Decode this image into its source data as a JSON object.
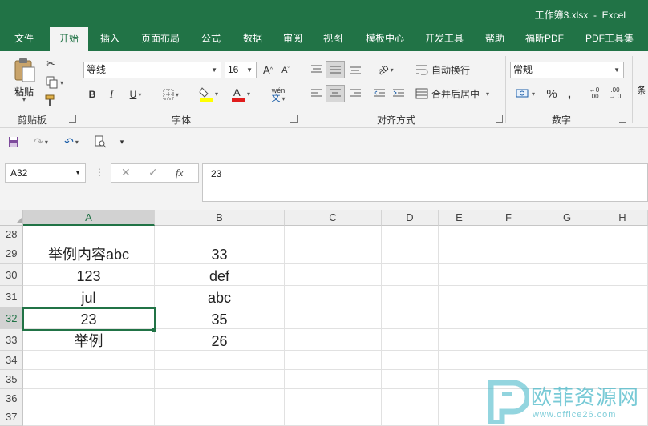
{
  "window": {
    "title": "工作簿3.xlsx  -  Excel"
  },
  "tabs": [
    {
      "label": "文件"
    },
    {
      "label": "开始"
    },
    {
      "label": "插入"
    },
    {
      "label": "页面布局"
    },
    {
      "label": "公式"
    },
    {
      "label": "数据"
    },
    {
      "label": "审阅"
    },
    {
      "label": "视图"
    },
    {
      "label": "模板中心"
    },
    {
      "label": "开发工具"
    },
    {
      "label": "帮助"
    },
    {
      "label": "福昕PDF"
    },
    {
      "label": "PDF工具集"
    }
  ],
  "ribbon": {
    "clipboard": {
      "paste_label": "粘贴",
      "group_label": "剪贴板"
    },
    "font": {
      "font_name": "等线",
      "font_size": "16",
      "group_label": "字体",
      "phonetic_label": "wén"
    },
    "alignment": {
      "wrap_text": "自动换行",
      "merge_center": "合并后居中",
      "group_label": "对齐方式"
    },
    "number": {
      "format": "常规",
      "group_label": "数字"
    },
    "styles": {
      "partial_label": "条"
    }
  },
  "formula_bar": {
    "name_box": "A32",
    "fx": "fx",
    "content": "23"
  },
  "grid": {
    "columns": [
      "A",
      "B",
      "C",
      "D",
      "E",
      "F",
      "G",
      "H"
    ],
    "rows": [
      {
        "num": "28",
        "a": "",
        "b": ""
      },
      {
        "num": "29",
        "a": "举例内容abc",
        "b": "33"
      },
      {
        "num": "30",
        "a": "123",
        "b": "def"
      },
      {
        "num": "31",
        "a": "jul",
        "b": "abc"
      },
      {
        "num": "32",
        "a": "23",
        "b": "35"
      },
      {
        "num": "33",
        "a": "举例",
        "b": "26"
      },
      {
        "num": "34",
        "a": "",
        "b": ""
      },
      {
        "num": "35",
        "a": "",
        "b": ""
      },
      {
        "num": "36",
        "a": "",
        "b": ""
      },
      {
        "num": "37",
        "a": "",
        "b": ""
      }
    ],
    "active_cell": "A32"
  },
  "watermark": {
    "name": "欧菲资源网",
    "url": "www.office26.com"
  },
  "colors": {
    "excel_green": "#217346",
    "watermark": "#4bb9c9"
  }
}
